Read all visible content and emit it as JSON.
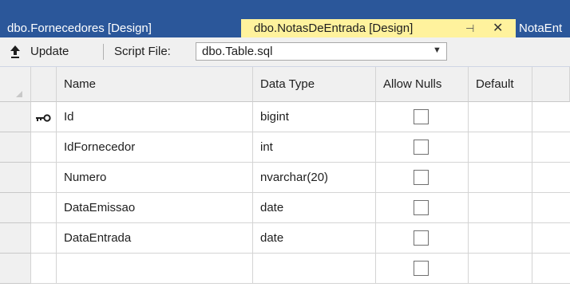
{
  "tabs": [
    {
      "label": "dbo.Fornecedores [Design]"
    },
    {
      "label": "dbo.NotasDeEntrada [Design]",
      "pin_glyph": "⊣",
      "close_glyph": "✕"
    },
    {
      "label": "NotaEnt"
    }
  ],
  "toolbar": {
    "update_label": "Update",
    "script_file_label": "Script File:",
    "script_file_value": "dbo.Table.sql"
  },
  "grid": {
    "columns": [
      "Name",
      "Data Type",
      "Allow Nulls",
      "Default"
    ],
    "rows": [
      {
        "name": "Id",
        "type": "bigint",
        "allow_nulls": false,
        "primary_key": true
      },
      {
        "name": "IdFornecedor",
        "type": "int",
        "allow_nulls": false
      },
      {
        "name": "Numero",
        "type": "nvarchar(20)",
        "allow_nulls": false
      },
      {
        "name": "DataEmissao",
        "type": "date",
        "allow_nulls": false
      },
      {
        "name": "DataEntrada",
        "type": "date",
        "allow_nulls": false
      },
      {
        "name": "",
        "type": "",
        "allow_nulls": false
      }
    ]
  },
  "colors": {
    "tab_strip": "#2b579a",
    "active_tab": "#fff29d",
    "toolbar": "#f0f0f0"
  },
  "icons": [
    "update-arrow-icon",
    "dropdown-arrow-icon",
    "primary-key-icon"
  ]
}
